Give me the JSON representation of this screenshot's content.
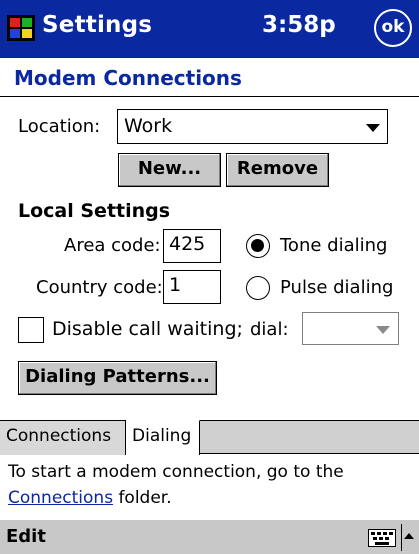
{
  "titlebar": {
    "icon": "windows-flag-icon",
    "title": "Settings",
    "time": "3:58p",
    "ok_label": "ok"
  },
  "page": {
    "title": "Modem Connections"
  },
  "location": {
    "label": "Location:",
    "value": "Work",
    "new_button": "New...",
    "remove_button": "Remove"
  },
  "local_settings": {
    "heading": "Local Settings",
    "area_code_label": "Area code:",
    "area_code_value": "425",
    "country_code_label": "Country code:",
    "country_code_value": "1",
    "tone_dialing_label": "Tone dialing",
    "tone_dialing_selected": true,
    "pulse_dialing_label": "Pulse dialing",
    "pulse_dialing_selected": false,
    "disable_call_waiting_label": "Disable call waiting;",
    "disable_call_waiting_checked": false,
    "dial_label": "dial:",
    "dial_value": "",
    "dialing_patterns_button": "Dialing Patterns..."
  },
  "tabs": [
    {
      "label": "Connections",
      "active": false
    },
    {
      "label": "Dialing",
      "active": true
    }
  ],
  "footnote": {
    "line1": "To start a modem connection, go to the",
    "link": "Connections",
    "line2_rest": " folder."
  },
  "command_bar": {
    "edit_label": "Edit",
    "keyboard_icon": "keyboard-icon",
    "sip_arrow_icon": "arrow-up-icon"
  },
  "colors": {
    "titlebar": "#0a28a0",
    "accent_text": "#0a28a0",
    "button_face": "#c8c8c8"
  }
}
